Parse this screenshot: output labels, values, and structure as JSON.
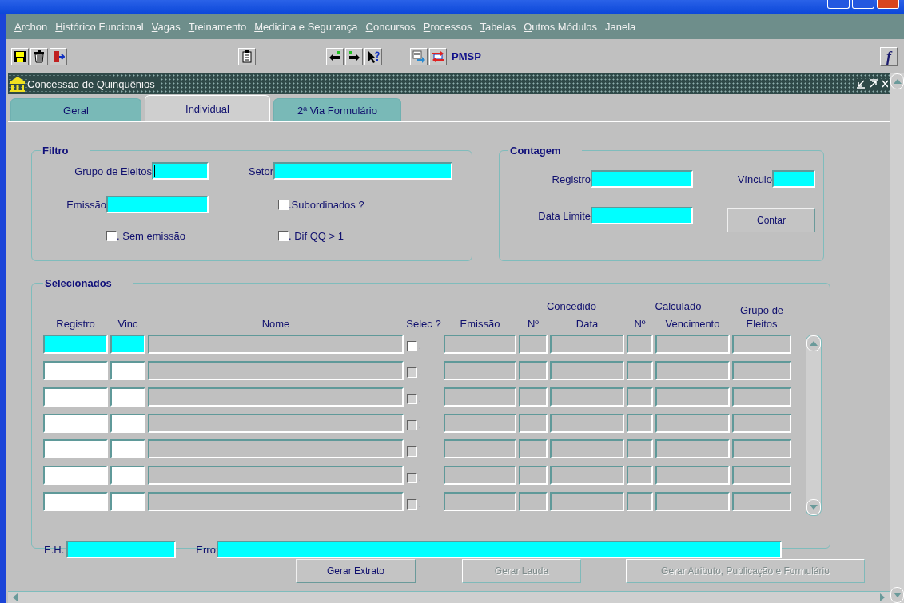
{
  "menu": [
    {
      "label": "Archon",
      "mnemonic": true
    },
    {
      "label": "Histórico Funcional",
      "mnemonic": true
    },
    {
      "label": "Vagas",
      "mnemonic": true
    },
    {
      "label": "Treinamento",
      "mnemonic": true
    },
    {
      "label": "Medicina e Segurança",
      "mnemonic": true
    },
    {
      "label": "Concursos",
      "mnemonic": true
    },
    {
      "label": "Processos",
      "mnemonic": true
    },
    {
      "label": "Tabelas",
      "mnemonic": true
    },
    {
      "label": "Outros Módulos",
      "mnemonic": true
    },
    {
      "label": "Janela",
      "mnemonic": false
    }
  ],
  "toolbar": {
    "org_label": "PMSP",
    "function_button": "f"
  },
  "form_window": {
    "title": "Concessão de Quinquênios"
  },
  "tabs": [
    {
      "label": "Geral",
      "selected": false
    },
    {
      "label": "Individual",
      "selected": true
    },
    {
      "label": "2ª Via Formulário",
      "selected": false
    }
  ],
  "filtro": {
    "title": "Filtro",
    "fields": [
      {
        "label": "Grupo de Eleitos",
        "focused": true
      },
      {
        "label": "Setor",
        "focused": false
      },
      {
        "label": "Emissão",
        "focused": false
      }
    ],
    "checkboxes": [
      {
        "label": ".Subordinados ?",
        "checked": false
      },
      {
        "label": ". Sem emissão",
        "checked": false
      },
      {
        "label": ". Dif QQ > 1",
        "checked": false
      }
    ]
  },
  "contagem": {
    "title": "Contagem",
    "fields": [
      {
        "label": "Registro",
        "focused": false
      },
      {
        "label": "Vínculo",
        "focused": false
      },
      {
        "label": "Data Limite",
        "focused": false
      }
    ],
    "button": {
      "label": "Contar",
      "disabled": false
    }
  },
  "selecionados": {
    "title": "Selecionados",
    "columns": [
      {
        "label": "Registro",
        "editable": true
      },
      {
        "label": "Vinc",
        "editable": true
      },
      {
        "label": "Nome",
        "editable": false
      },
      {
        "label": "Selec ?",
        "kind": "checkbox"
      },
      {
        "label": "Emissão",
        "editable": false
      },
      {
        "group": "Concedido",
        "columns": [
          {
            "label": "Nº",
            "editable": false
          },
          {
            "label": "Data",
            "editable": false
          }
        ]
      },
      {
        "group": "Calculado",
        "columns": [
          {
            "label": "Nº",
            "editable": false
          },
          {
            "label": "Vencimento",
            "editable": false
          }
        ]
      },
      {
        "label": "Grupo de Eleitos",
        "editable": false
      }
    ],
    "rows": [
      {
        "current": true,
        "checked": false,
        "check_label": "."
      },
      {
        "current": false,
        "checked": false,
        "check_label": "."
      },
      {
        "current": false,
        "checked": false,
        "check_label": "."
      },
      {
        "current": false,
        "checked": false,
        "check_label": "."
      },
      {
        "current": false,
        "checked": false,
        "check_label": "."
      },
      {
        "current": false,
        "checked": false,
        "check_label": "."
      },
      {
        "current": false,
        "checked": false,
        "check_label": "."
      }
    ],
    "fields": [
      {
        "label": "E.H.",
        "focused": false
      },
      {
        "label": "Erro",
        "focused": false
      }
    ]
  },
  "buttons": [
    {
      "label": "Gerar Extrato",
      "disabled": false
    },
    {
      "label": "Gerar Lauda",
      "disabled": true
    },
    {
      "label": "Gerar Atributo, Publicação e Formulário",
      "disabled": true
    }
  ]
}
